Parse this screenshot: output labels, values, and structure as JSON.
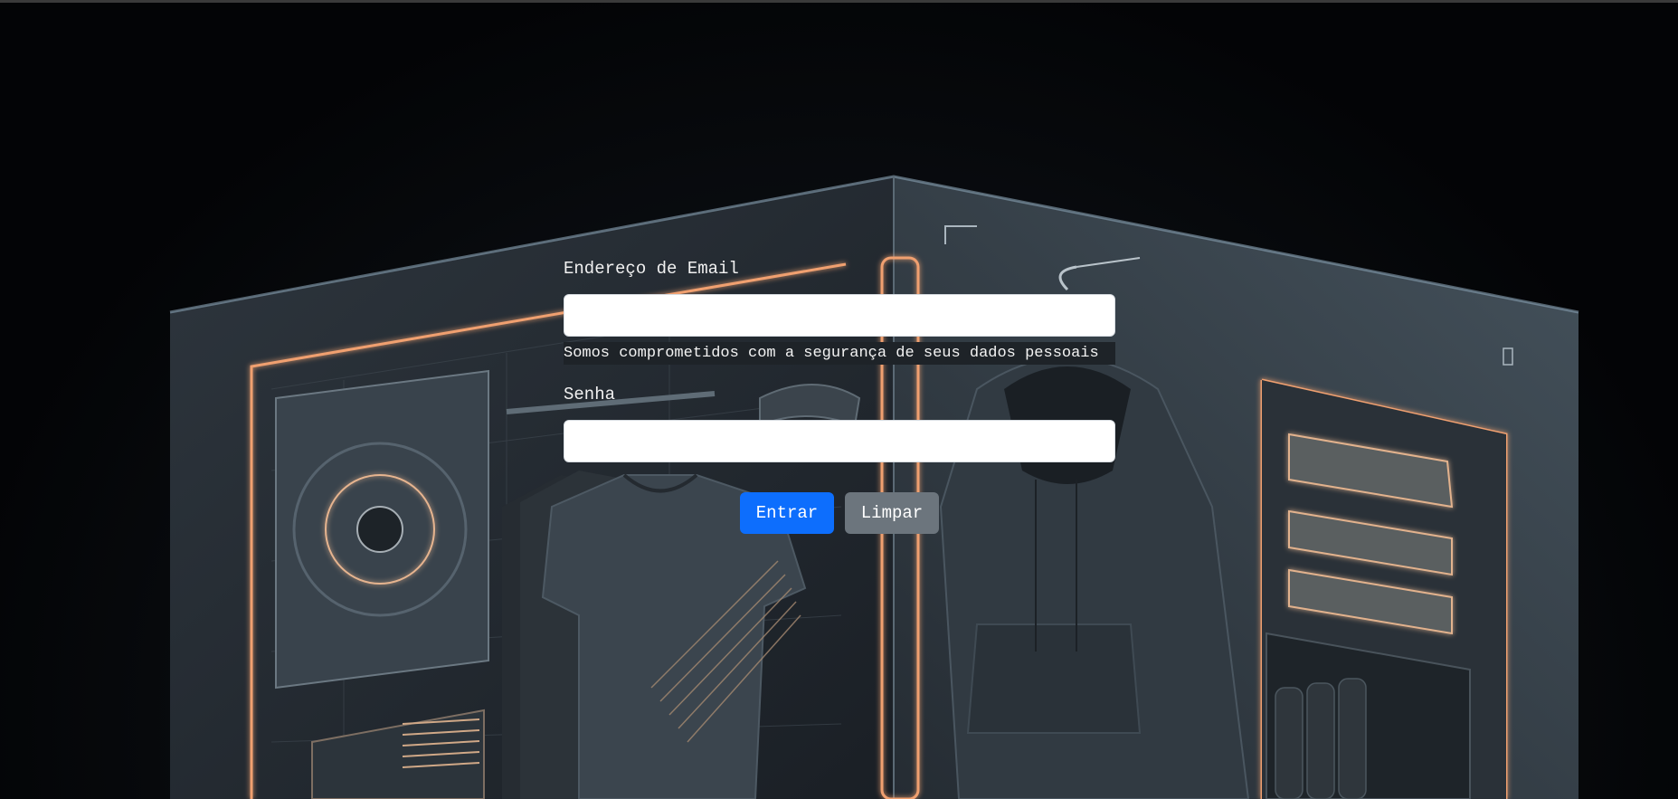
{
  "form": {
    "email_label": "Endereço de Email",
    "email_value": "",
    "email_help": "Somos comprometidos com a segurança de seus dados pessoais",
    "password_label": "Senha",
    "password_value": "",
    "submit_label": "Entrar",
    "reset_label": "Limpar"
  },
  "colors": {
    "primary": "#0d6efd",
    "secondary": "#6c757d",
    "background": "#040507",
    "neon": "#f0a070"
  },
  "background": {
    "image": "neon-clothing-display-room"
  }
}
